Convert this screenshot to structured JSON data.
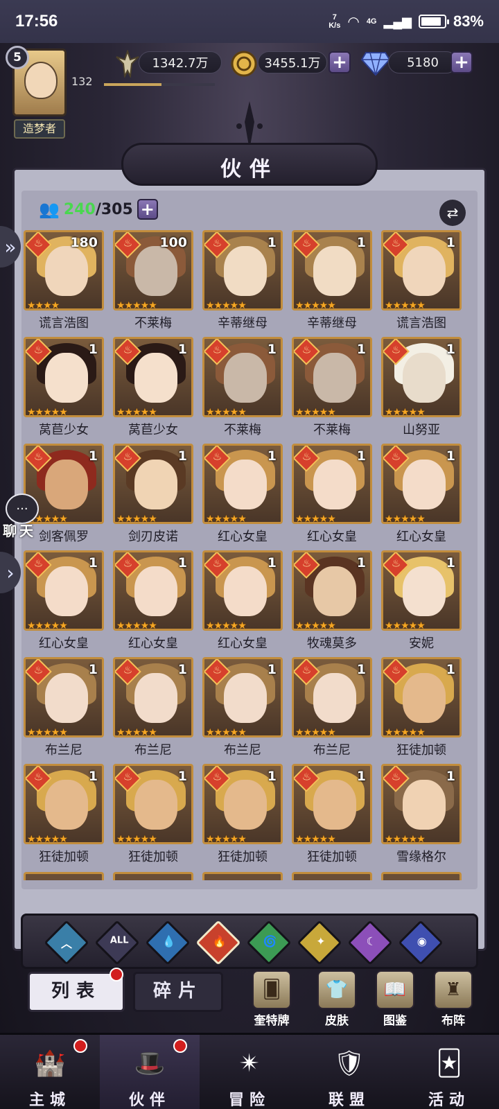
{
  "status_bar": {
    "time": "17:56",
    "net_speed_value": "7",
    "net_speed_unit": "K/s",
    "network": "4G",
    "battery": "83%"
  },
  "player": {
    "level": "5",
    "exp_value": "132",
    "title": "造梦者",
    "exp_progress": 0.52
  },
  "resources": {
    "power": "1342.7万",
    "gold": "3455.1万",
    "diamonds": "5180"
  },
  "panel": {
    "title": "伙伴",
    "capacity_current": "240",
    "capacity_sep": "/",
    "capacity_max": "305"
  },
  "partners": [
    {
      "name": "谎言浩图",
      "count": "180",
      "stars": 4,
      "skin": "#f0d6bb",
      "hair": "#e0b35f"
    },
    {
      "name": "不莱梅",
      "count": "100",
      "stars": 5,
      "skin": "#c9b8a8",
      "hair": "#8b5a3a"
    },
    {
      "name": "辛蒂继母",
      "count": "1",
      "stars": 5,
      "skin": "#f1dcc4",
      "hair": "#a9824d"
    },
    {
      "name": "辛蒂继母",
      "count": "1",
      "stars": 5,
      "skin": "#f1dcc4",
      "hair": "#a9824d"
    },
    {
      "name": "谎言浩图",
      "count": "1",
      "stars": 5,
      "skin": "#f0d6bb",
      "hair": "#e0b35f"
    },
    {
      "name": "莴苣少女",
      "count": "1",
      "stars": 5,
      "skin": "#f5e0cc",
      "hair": "#2a1a16"
    },
    {
      "name": "莴苣少女",
      "count": "1",
      "stars": 5,
      "skin": "#f5e0cc",
      "hair": "#2a1a16"
    },
    {
      "name": "不莱梅",
      "count": "1",
      "stars": 5,
      "skin": "#c9b8a8",
      "hair": "#8b5a3a"
    },
    {
      "name": "不莱梅",
      "count": "1",
      "stars": 5,
      "skin": "#c9b8a8",
      "hair": "#8b5a3a"
    },
    {
      "name": "山努亚",
      "count": "1",
      "stars": 5,
      "skin": "#e8dccb",
      "hair": "#f3efe4"
    },
    {
      "name": "剑客佩罗",
      "count": "1",
      "stars": 5,
      "skin": "#d9a77a",
      "hair": "#8e2a1e"
    },
    {
      "name": "剑刃皮诺",
      "count": "1",
      "stars": 5,
      "skin": "#f0d4b4",
      "hair": "#5a3a24"
    },
    {
      "name": "红心女皇",
      "count": "1",
      "stars": 5,
      "skin": "#f4dcc9",
      "hair": "#c9964f"
    },
    {
      "name": "红心女皇",
      "count": "1",
      "stars": 5,
      "skin": "#f4dcc9",
      "hair": "#c9964f"
    },
    {
      "name": "红心女皇",
      "count": "1",
      "stars": 5,
      "skin": "#f4dcc9",
      "hair": "#c9964f"
    },
    {
      "name": "红心女皇",
      "count": "1",
      "stars": 5,
      "skin": "#f4dcc9",
      "hair": "#c9964f"
    },
    {
      "name": "红心女皇",
      "count": "1",
      "stars": 5,
      "skin": "#f4dcc9",
      "hair": "#c9964f"
    },
    {
      "name": "红心女皇",
      "count": "1",
      "stars": 5,
      "skin": "#f4dcc9",
      "hair": "#c9964f"
    },
    {
      "name": "牧魂莫多",
      "count": "1",
      "stars": 5,
      "skin": "#e7c8a6",
      "hair": "#5a3422"
    },
    {
      "name": "安妮",
      "count": "1",
      "stars": 5,
      "skin": "#f4e0cf",
      "hair": "#e7c26a"
    },
    {
      "name": "布兰尼",
      "count": "1",
      "stars": 5,
      "skin": "#f2dccb",
      "hair": "#a8804c"
    },
    {
      "name": "布兰尼",
      "count": "1",
      "stars": 5,
      "skin": "#f2dccb",
      "hair": "#a8804c"
    },
    {
      "name": "布兰尼",
      "count": "1",
      "stars": 5,
      "skin": "#f2dccb",
      "hair": "#a8804c"
    },
    {
      "name": "布兰尼",
      "count": "1",
      "stars": 5,
      "skin": "#f2dccb",
      "hair": "#a8804c"
    },
    {
      "name": "狂徒加顿",
      "count": "1",
      "stars": 5,
      "skin": "#e4b98c",
      "hair": "#d8a94e"
    },
    {
      "name": "狂徒加顿",
      "count": "1",
      "stars": 5,
      "skin": "#e4b98c",
      "hair": "#d8a94e"
    },
    {
      "name": "狂徒加顿",
      "count": "1",
      "stars": 5,
      "skin": "#e4b98c",
      "hair": "#d8a94e"
    },
    {
      "name": "狂徒加顿",
      "count": "1",
      "stars": 5,
      "skin": "#e4b98c",
      "hair": "#d8a94e"
    },
    {
      "name": "狂徒加顿",
      "count": "1",
      "stars": 5,
      "skin": "#e4b98c",
      "hair": "#d8a94e"
    },
    {
      "name": "雪缘格尔",
      "count": "1",
      "stars": 5,
      "skin": "#f0d2b3",
      "hair": "#8a6a4a"
    }
  ],
  "filters": [
    {
      "icon": "chevron-up-icon",
      "label": "︿",
      "color": "#3a7fa8"
    },
    {
      "icon": "all-icon",
      "label": "ALL",
      "color": "#3d3a55"
    },
    {
      "icon": "water-drop-icon",
      "label": "💧",
      "color": "#2f6fb0"
    },
    {
      "icon": "fire-icon",
      "label": "🔥",
      "color": "#c8412c"
    },
    {
      "icon": "wind-icon",
      "label": "🌀",
      "color": "#3c9b54"
    },
    {
      "icon": "light-icon",
      "label": "✦",
      "color": "#c8a83a"
    },
    {
      "icon": "moon-icon",
      "label": "☾",
      "color": "#8c4fb9"
    },
    {
      "icon": "planet-icon",
      "label": "◉",
      "color": "#3f4fb0"
    }
  ],
  "tabs": {
    "list": "列表",
    "pieces": "碎片"
  },
  "utilities": [
    {
      "icon": "card-deck-icon",
      "label": "奎特牌",
      "glyph": "🂠"
    },
    {
      "icon": "skin-icon",
      "label": "皮肤",
      "glyph": "👕"
    },
    {
      "icon": "catalog-icon",
      "label": "图鉴",
      "glyph": "📖"
    },
    {
      "icon": "formation-icon",
      "label": "布阵",
      "glyph": "♜"
    }
  ],
  "bottom_nav": [
    {
      "icon": "castle-icon",
      "label": "主城",
      "glyph": "🏰",
      "active": false,
      "badge": true
    },
    {
      "icon": "partner-hat-icon",
      "label": "伙伴",
      "glyph": "🎩",
      "active": true,
      "badge": true
    },
    {
      "icon": "adventure-icon",
      "label": "冒险",
      "glyph": "✴",
      "active": false,
      "badge": false
    },
    {
      "icon": "alliance-shield-icon",
      "label": "联盟",
      "glyph": "🛡",
      "active": false,
      "badge": false
    },
    {
      "icon": "activity-cards-icon",
      "label": "活动",
      "glyph": "🃏",
      "active": false,
      "badge": false
    }
  ],
  "side": {
    "chat_label": "聊天"
  }
}
